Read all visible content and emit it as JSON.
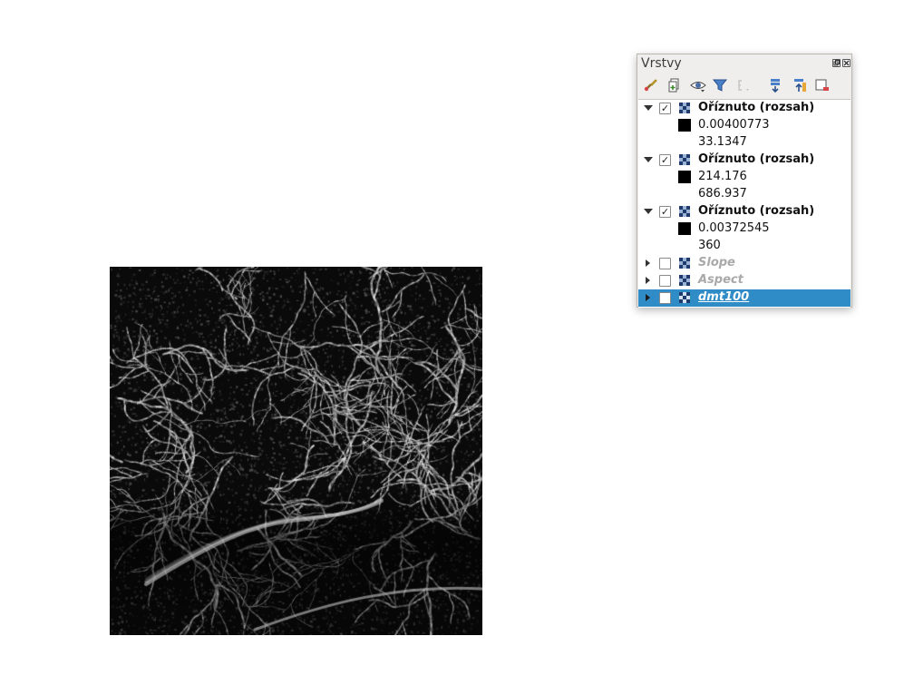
{
  "layers_panel": {
    "title": "Vrstvy",
    "title_buttons": [
      "restore-icon",
      "close-icon"
    ],
    "toolbar": [
      "style-manager-icon",
      "add-group-icon",
      "visibility-eye-icon",
      "filter-legend-icon",
      "filter-expression-icon",
      "expand-all-icon",
      "collapse-all-icon",
      "remove-layer-icon"
    ],
    "layers": [
      {
        "name": "Oříznuto (rozsah)",
        "checked": true,
        "expanded": true,
        "min": "0.00400773",
        "max": "33.1347"
      },
      {
        "name": "Oříznuto (rozsah)",
        "checked": true,
        "expanded": true,
        "min": "214.176",
        "max": "686.937"
      },
      {
        "name": "Oříznuto (rozsah)",
        "checked": true,
        "expanded": true,
        "min": "0.00372545",
        "max": "360"
      },
      {
        "name": "Slope",
        "checked": false,
        "expanded": false
      },
      {
        "name": "Aspect",
        "checked": false,
        "expanded": false
      },
      {
        "name": "dmt100",
        "checked": false,
        "expanded": false,
        "selected": true
      }
    ]
  },
  "map": {
    "background": "#ffffff",
    "raster_colors": {
      "low": "#000000",
      "high": "#ffffff"
    }
  },
  "colors": {
    "selection": "#308cc6",
    "panel_bg": "#efeeec",
    "disabled_text": "#a9a9a9"
  }
}
